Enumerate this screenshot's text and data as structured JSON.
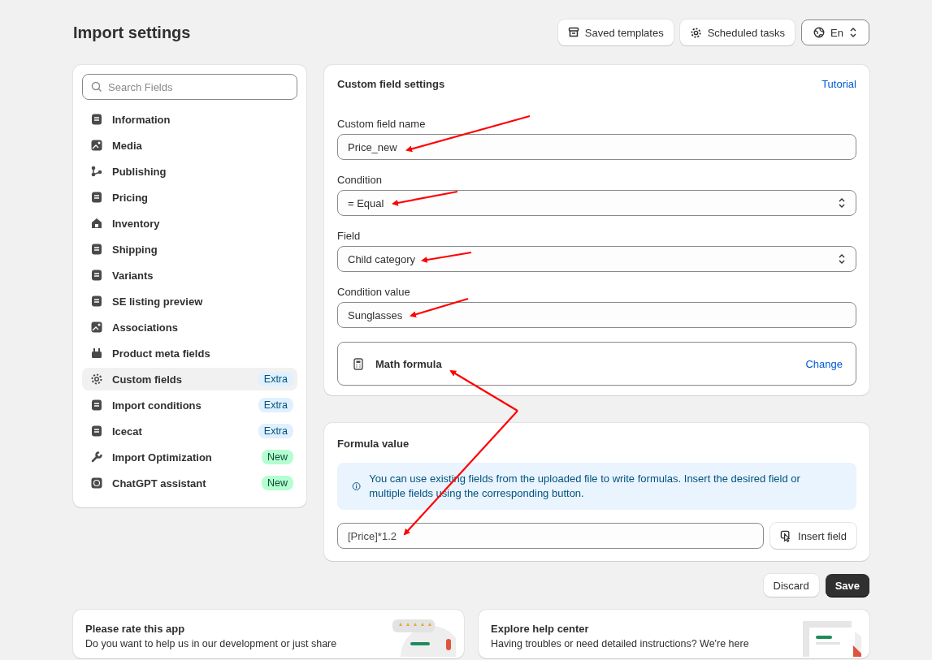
{
  "page": {
    "title": "Import settings"
  },
  "header_buttons": [
    {
      "kind": "templates",
      "label": "Saved templates"
    },
    {
      "kind": "tasks",
      "label": "Scheduled tasks"
    },
    {
      "kind": "language",
      "label": "En"
    }
  ],
  "sidebar": {
    "search": {
      "placeholder": "Search Fields"
    },
    "items": [
      {
        "label": "Information",
        "selected": false
      },
      {
        "label": "Media",
        "selected": false
      },
      {
        "label": "Publishing",
        "selected": false
      },
      {
        "label": "Pricing",
        "selected": false
      },
      {
        "label": "Inventory",
        "selected": false
      },
      {
        "label": "Shipping",
        "selected": false
      },
      {
        "label": "Variants",
        "selected": false
      },
      {
        "label": "SE listing preview",
        "selected": false
      },
      {
        "label": "Associations",
        "selected": false
      },
      {
        "label": "Product meta fields",
        "selected": false
      },
      {
        "label": "Custom fields",
        "selected": true,
        "badge": {
          "kind": "extra",
          "text": "Extra"
        }
      },
      {
        "label": "Import conditions",
        "selected": false,
        "badge": {
          "kind": "extra",
          "text": "Extra"
        }
      },
      {
        "label": "Icecat",
        "selected": false,
        "badge": {
          "kind": "extra",
          "text": "Extra"
        }
      },
      {
        "label": "Import Optimization",
        "selected": false,
        "badge": {
          "kind": "new",
          "text": "New"
        }
      },
      {
        "label": "ChatGPT assistant",
        "selected": false,
        "badge": {
          "kind": "new",
          "text": "New"
        }
      }
    ]
  },
  "custom_field_settings": {
    "title": "Custom field settings",
    "tutorial_link": "Tutorial",
    "fields": [
      {
        "kind": "text",
        "label": "Custom field name",
        "value": "Price_new"
      },
      {
        "kind": "select",
        "label": "Condition",
        "value": "= Equal"
      },
      {
        "kind": "select",
        "label": "Field",
        "value": "Child category"
      },
      {
        "kind": "text",
        "label": "Condition value",
        "value": "Sunglasses"
      }
    ],
    "formula_type": {
      "label": "Math formula",
      "action": "Change"
    }
  },
  "formula_value": {
    "title": "Formula value",
    "info": "You can use existing fields from the uploaded file to write formulas. Insert the desired field or multiple fields using the corresponding button.",
    "value": "[Price]*1.2",
    "button": "Insert field"
  },
  "actions": [
    "Discard",
    "Save"
  ],
  "bottom_cards": [
    {
      "kind": "rate",
      "title": "Please rate this app",
      "text": "Do you want to help us in our development or just share"
    },
    {
      "kind": "help",
      "title": "Explore help center",
      "text": "Having troubles or need detailed instructions? We're here"
    }
  ]
}
